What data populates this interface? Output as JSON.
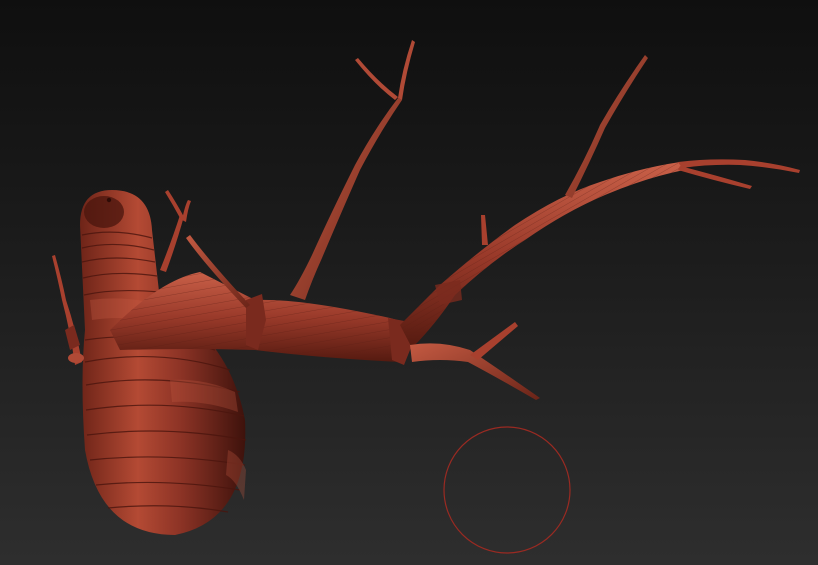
{
  "viewport": {
    "background_top": "#0f0f0f",
    "background_bottom": "#2e2e2e"
  },
  "model": {
    "material_light": "#c45a42",
    "material_mid": "#8e3426",
    "material_dark": "#4a150e",
    "segment_line": "#5a1c12"
  },
  "brush_cursor": {
    "icon": "brush-circle-icon",
    "stroke": "#9a2a22"
  }
}
